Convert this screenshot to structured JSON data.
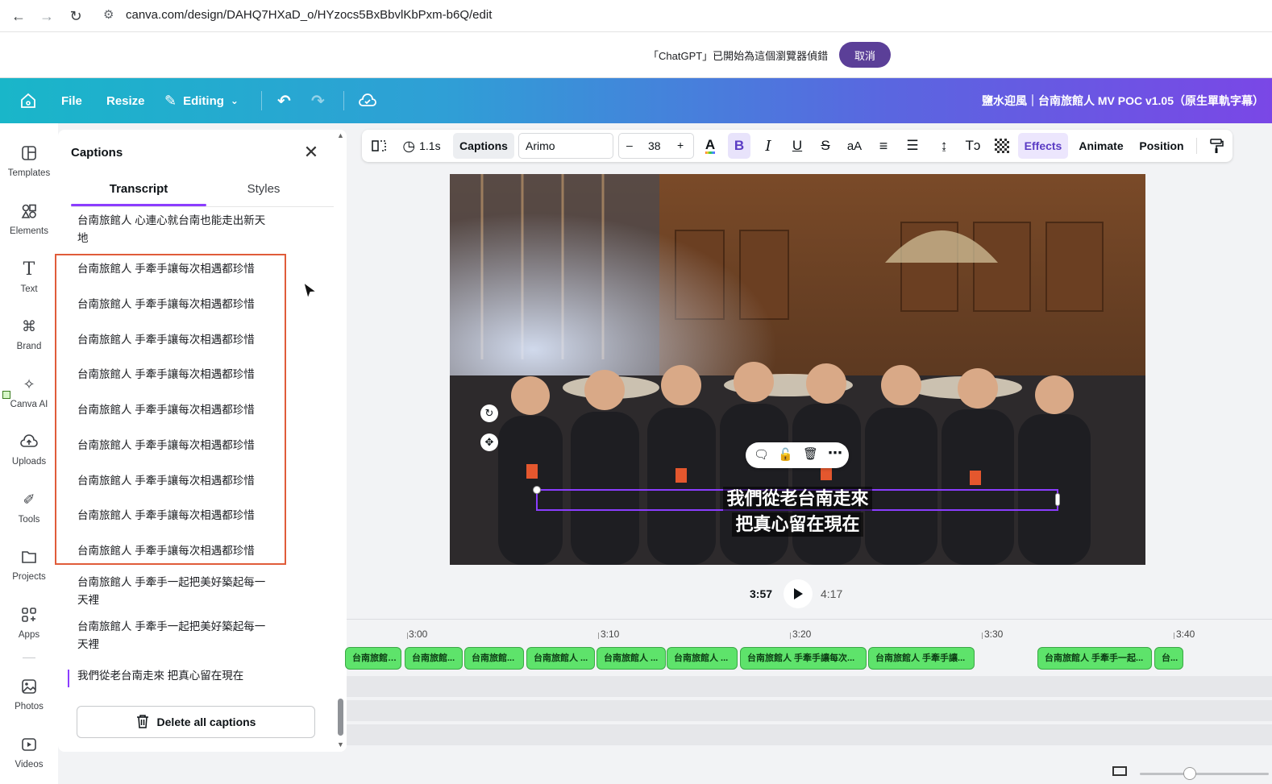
{
  "browser": {
    "url": "canva.com/design/DAHQ7HXaD_o/HYzocs5BxBbvlKbPxm-b6Q/edit"
  },
  "debug_banner": {
    "message": "「ChatGPT」已開始為這個瀏覽器偵錯",
    "cancel_label": "取消"
  },
  "topbar": {
    "file_label": "File",
    "resize_label": "Resize",
    "editing_label": "Editing",
    "title": "鹽水迎風｜台南旅館人 MV POC v1.05（原生單軌字幕）"
  },
  "rail": {
    "items": [
      {
        "label": "Templates",
        "icon": "templates-icon"
      },
      {
        "label": "Elements",
        "icon": "elements-icon"
      },
      {
        "label": "Text",
        "icon": "text-icon"
      },
      {
        "label": "Brand",
        "icon": "brand-icon"
      },
      {
        "label": "Canva AI",
        "icon": "canva-ai-icon"
      },
      {
        "label": "Uploads",
        "icon": "uploads-icon"
      },
      {
        "label": "Tools",
        "icon": "tools-icon"
      },
      {
        "label": "Projects",
        "icon": "projects-icon"
      },
      {
        "label": "Apps",
        "icon": "apps-icon"
      },
      {
        "label": "Photos",
        "icon": "photos-icon"
      },
      {
        "label": "Videos",
        "icon": "videos-icon"
      }
    ]
  },
  "panel": {
    "title": "Captions",
    "tabs": [
      "Transcript",
      "Styles"
    ],
    "captions": [
      "台南旅館人 心連心就台南也能走出新天地",
      "台南旅館人 手牽手讓每次相遇都珍惜",
      "台南旅館人 手牽手讓每次相遇都珍惜",
      "台南旅館人 手牽手讓每次相遇都珍惜",
      "台南旅館人 手牽手讓每次相遇都珍惜",
      "台南旅館人 手牽手讓每次相遇都珍惜",
      "台南旅館人 手牽手讓每次相遇都珍惜",
      "台南旅館人 手牽手讓每次相遇都珍惜",
      "台南旅館人 手牽手讓每次相遇都珍惜",
      "台南旅館人 手牽手讓每次相遇都珍惜",
      "台南旅館人 手牽手一起把美好築起每一天裡",
      "台南旅館人 手牽手一起把美好築起每一天裡",
      "我們從老台南走來 把真心留在現在"
    ],
    "delete_all_label": "Delete all captions"
  },
  "toolbar": {
    "duration": "1.1s",
    "captions_label": "Captions",
    "font": "Arimo",
    "font_size": "38",
    "minus": "–",
    "plus": "+",
    "effects_label": "Effects",
    "animate_label": "Animate",
    "position_label": "Position",
    "accent_color": "#8b3dff"
  },
  "canvas": {
    "caption_line1": "我們從老台南走來",
    "caption_line2": "把真心留在現在"
  },
  "playback": {
    "current": "3:57",
    "total": "4:17"
  },
  "timeline": {
    "ruler": [
      "3:00",
      "3:10",
      "3:20",
      "3:30",
      "3:40"
    ],
    "clips": [
      "台南旅館人 手牽...",
      "台南旅館...",
      "台南旅館...",
      "台南旅館人 ...",
      "台南旅館人 ...",
      "台南旅館人 ...",
      "台南旅館人 手牽手讓每次...",
      "台南旅館人 手牽手讓...",
      "台南旅館人 手牽手一起...",
      "台..."
    ],
    "clip_color": "#5ee36b"
  }
}
